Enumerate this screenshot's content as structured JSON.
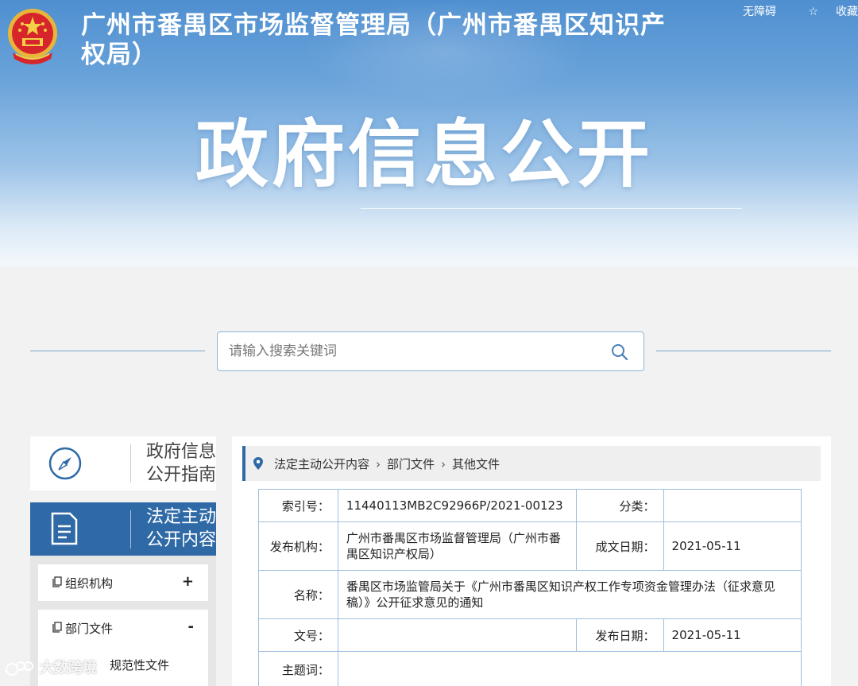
{
  "header": {
    "site_title": "广州市番禺区市场监督管理局（广州市番禺区知识产权局）",
    "banner_title": "政府信息公开",
    "top_links": {
      "accessibility": "无障碍",
      "favorite": "收藏"
    },
    "emblem_icon": "national-emblem-icon"
  },
  "search": {
    "placeholder": "请输入搜索关键词",
    "value": "",
    "icon": "search-icon"
  },
  "sidebar": {
    "guide": {
      "label": "政府信息公开指南",
      "icon": "compass-icon"
    },
    "active_section": {
      "label": "法定主动公开内容",
      "icon": "document-icon"
    },
    "items": [
      {
        "label": "组织机构",
        "sign": "+"
      },
      {
        "label": "部门文件",
        "sign": "-"
      }
    ],
    "sub_items": [
      {
        "label": "规范性文件"
      }
    ]
  },
  "breadcrumb": {
    "items": [
      "法定主动公开内容",
      "部门文件",
      "其他文件"
    ],
    "separator": "›"
  },
  "document_info": {
    "index_label": "索引号：",
    "index_value": "11440113MB2C92966P/2021-00123",
    "category_label": "分类：",
    "category_value": "",
    "publisher_label": "发布机构：",
    "publisher_value": "广州市番禺区市场监督管理局（广州市番禺区知识产权局）",
    "created_label": "成文日期：",
    "created_value": "2021-05-11",
    "name_label": "名称：",
    "name_value": "番禺区市场监管局关于《广州市番禺区知识产权工作专项资金管理办法（征求意见稿）》公开征求意见的通知",
    "doc_no_label": "文号：",
    "doc_no_value": "",
    "published_label": "发布日期：",
    "published_value": "2021-05-11",
    "subject_label": "主题词：",
    "subject_value": ""
  },
  "watermark": {
    "text": "大数跨境"
  },
  "colors": {
    "primary": "#2f6aa7",
    "header_top": "#4f8fd0",
    "border": "#9fbedd"
  }
}
